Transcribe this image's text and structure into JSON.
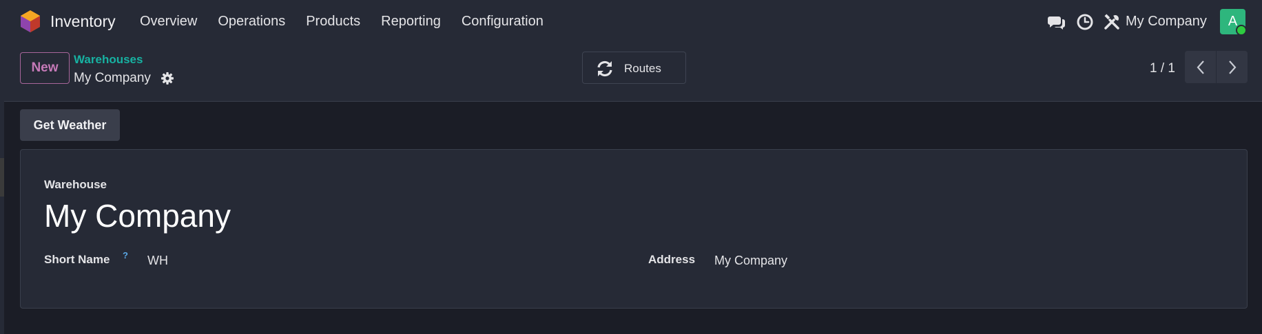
{
  "navbar": {
    "app_name": "Inventory",
    "app_icon": "odoo-inventory-icon",
    "menu": [
      "Overview",
      "Operations",
      "Products",
      "Reporting",
      "Configuration"
    ],
    "systray_icons": [
      "chat-icon",
      "clock-icon",
      "tools-icon"
    ],
    "company": "My Company",
    "avatar_initial": "A",
    "avatar_color": "#2eb67d"
  },
  "control_panel": {
    "new_label": "New",
    "breadcrumb_parent": "Warehouses",
    "breadcrumb_current": "My Company",
    "routes_label": "Routes",
    "pager": "1 / 1"
  },
  "header_buttons": {
    "weather_label": "Get Weather"
  },
  "form": {
    "warehouse_label": "Warehouse",
    "warehouse_name": "My Company",
    "short_name_label": "Short Name",
    "short_name_help": "?",
    "short_name_value": "WH",
    "address_label": "Address",
    "address_value": "My Company"
  },
  "colors": {
    "accent_teal": "#17b2a2",
    "new_button": "#c67ab8",
    "background": "#1b1d26",
    "panel": "#262a36"
  }
}
